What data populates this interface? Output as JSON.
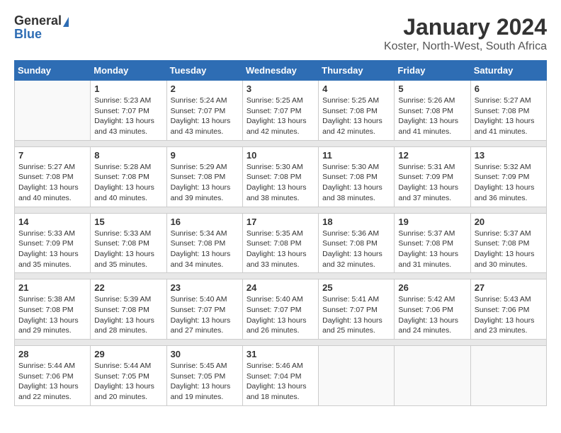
{
  "logo": {
    "general": "General",
    "blue": "Blue"
  },
  "title": "January 2024",
  "subtitle": "Koster, North-West, South Africa",
  "days_header": [
    "Sunday",
    "Monday",
    "Tuesday",
    "Wednesday",
    "Thursday",
    "Friday",
    "Saturday"
  ],
  "weeks": [
    [
      {
        "day": "",
        "sunrise": "",
        "sunset": "",
        "daylight": ""
      },
      {
        "day": "1",
        "sunrise": "Sunrise: 5:23 AM",
        "sunset": "Sunset: 7:07 PM",
        "daylight": "Daylight: 13 hours and 43 minutes."
      },
      {
        "day": "2",
        "sunrise": "Sunrise: 5:24 AM",
        "sunset": "Sunset: 7:07 PM",
        "daylight": "Daylight: 13 hours and 43 minutes."
      },
      {
        "day": "3",
        "sunrise": "Sunrise: 5:25 AM",
        "sunset": "Sunset: 7:07 PM",
        "daylight": "Daylight: 13 hours and 42 minutes."
      },
      {
        "day": "4",
        "sunrise": "Sunrise: 5:25 AM",
        "sunset": "Sunset: 7:08 PM",
        "daylight": "Daylight: 13 hours and 42 minutes."
      },
      {
        "day": "5",
        "sunrise": "Sunrise: 5:26 AM",
        "sunset": "Sunset: 7:08 PM",
        "daylight": "Daylight: 13 hours and 41 minutes."
      },
      {
        "day": "6",
        "sunrise": "Sunrise: 5:27 AM",
        "sunset": "Sunset: 7:08 PM",
        "daylight": "Daylight: 13 hours and 41 minutes."
      }
    ],
    [
      {
        "day": "7",
        "sunrise": "Sunrise: 5:27 AM",
        "sunset": "Sunset: 7:08 PM",
        "daylight": "Daylight: 13 hours and 40 minutes."
      },
      {
        "day": "8",
        "sunrise": "Sunrise: 5:28 AM",
        "sunset": "Sunset: 7:08 PM",
        "daylight": "Daylight: 13 hours and 40 minutes."
      },
      {
        "day": "9",
        "sunrise": "Sunrise: 5:29 AM",
        "sunset": "Sunset: 7:08 PM",
        "daylight": "Daylight: 13 hours and 39 minutes."
      },
      {
        "day": "10",
        "sunrise": "Sunrise: 5:30 AM",
        "sunset": "Sunset: 7:08 PM",
        "daylight": "Daylight: 13 hours and 38 minutes."
      },
      {
        "day": "11",
        "sunrise": "Sunrise: 5:30 AM",
        "sunset": "Sunset: 7:08 PM",
        "daylight": "Daylight: 13 hours and 38 minutes."
      },
      {
        "day": "12",
        "sunrise": "Sunrise: 5:31 AM",
        "sunset": "Sunset: 7:09 PM",
        "daylight": "Daylight: 13 hours and 37 minutes."
      },
      {
        "day": "13",
        "sunrise": "Sunrise: 5:32 AM",
        "sunset": "Sunset: 7:09 PM",
        "daylight": "Daylight: 13 hours and 36 minutes."
      }
    ],
    [
      {
        "day": "14",
        "sunrise": "Sunrise: 5:33 AM",
        "sunset": "Sunset: 7:09 PM",
        "daylight": "Daylight: 13 hours and 35 minutes."
      },
      {
        "day": "15",
        "sunrise": "Sunrise: 5:33 AM",
        "sunset": "Sunset: 7:08 PM",
        "daylight": "Daylight: 13 hours and 35 minutes."
      },
      {
        "day": "16",
        "sunrise": "Sunrise: 5:34 AM",
        "sunset": "Sunset: 7:08 PM",
        "daylight": "Daylight: 13 hours and 34 minutes."
      },
      {
        "day": "17",
        "sunrise": "Sunrise: 5:35 AM",
        "sunset": "Sunset: 7:08 PM",
        "daylight": "Daylight: 13 hours and 33 minutes."
      },
      {
        "day": "18",
        "sunrise": "Sunrise: 5:36 AM",
        "sunset": "Sunset: 7:08 PM",
        "daylight": "Daylight: 13 hours and 32 minutes."
      },
      {
        "day": "19",
        "sunrise": "Sunrise: 5:37 AM",
        "sunset": "Sunset: 7:08 PM",
        "daylight": "Daylight: 13 hours and 31 minutes."
      },
      {
        "day": "20",
        "sunrise": "Sunrise: 5:37 AM",
        "sunset": "Sunset: 7:08 PM",
        "daylight": "Daylight: 13 hours and 30 minutes."
      }
    ],
    [
      {
        "day": "21",
        "sunrise": "Sunrise: 5:38 AM",
        "sunset": "Sunset: 7:08 PM",
        "daylight": "Daylight: 13 hours and 29 minutes."
      },
      {
        "day": "22",
        "sunrise": "Sunrise: 5:39 AM",
        "sunset": "Sunset: 7:08 PM",
        "daylight": "Daylight: 13 hours and 28 minutes."
      },
      {
        "day": "23",
        "sunrise": "Sunrise: 5:40 AM",
        "sunset": "Sunset: 7:07 PM",
        "daylight": "Daylight: 13 hours and 27 minutes."
      },
      {
        "day": "24",
        "sunrise": "Sunrise: 5:40 AM",
        "sunset": "Sunset: 7:07 PM",
        "daylight": "Daylight: 13 hours and 26 minutes."
      },
      {
        "day": "25",
        "sunrise": "Sunrise: 5:41 AM",
        "sunset": "Sunset: 7:07 PM",
        "daylight": "Daylight: 13 hours and 25 minutes."
      },
      {
        "day": "26",
        "sunrise": "Sunrise: 5:42 AM",
        "sunset": "Sunset: 7:06 PM",
        "daylight": "Daylight: 13 hours and 24 minutes."
      },
      {
        "day": "27",
        "sunrise": "Sunrise: 5:43 AM",
        "sunset": "Sunset: 7:06 PM",
        "daylight": "Daylight: 13 hours and 23 minutes."
      }
    ],
    [
      {
        "day": "28",
        "sunrise": "Sunrise: 5:44 AM",
        "sunset": "Sunset: 7:06 PM",
        "daylight": "Daylight: 13 hours and 22 minutes."
      },
      {
        "day": "29",
        "sunrise": "Sunrise: 5:44 AM",
        "sunset": "Sunset: 7:05 PM",
        "daylight": "Daylight: 13 hours and 20 minutes."
      },
      {
        "day": "30",
        "sunrise": "Sunrise: 5:45 AM",
        "sunset": "Sunset: 7:05 PM",
        "daylight": "Daylight: 13 hours and 19 minutes."
      },
      {
        "day": "31",
        "sunrise": "Sunrise: 5:46 AM",
        "sunset": "Sunset: 7:04 PM",
        "daylight": "Daylight: 13 hours and 18 minutes."
      },
      {
        "day": "",
        "sunrise": "",
        "sunset": "",
        "daylight": ""
      },
      {
        "day": "",
        "sunrise": "",
        "sunset": "",
        "daylight": ""
      },
      {
        "day": "",
        "sunrise": "",
        "sunset": "",
        "daylight": ""
      }
    ]
  ]
}
